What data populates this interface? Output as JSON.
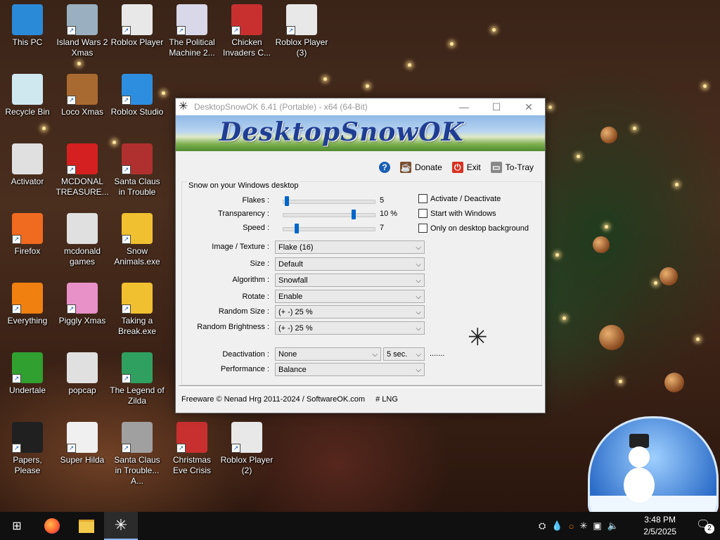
{
  "desktop": {
    "icons": [
      {
        "label": "This PC",
        "icon": "computer-icon",
        "color": "#2a8ad8",
        "shortcut": false
      },
      {
        "label": "Island Wars 2 Xmas",
        "icon": "game-icon",
        "color": "#9ab0c0",
        "shortcut": true
      },
      {
        "label": "Roblox Player",
        "icon": "roblox-icon",
        "color": "#e8e8e8",
        "shortcut": true
      },
      {
        "label": "The Political Machine 2...",
        "icon": "political-machine-icon",
        "color": "#d8d8e8",
        "shortcut": true
      },
      {
        "label": "Chicken Invaders C...",
        "icon": "chicken-invaders-icon",
        "color": "#c83030",
        "shortcut": true
      },
      {
        "label": "Roblox Player (3)",
        "icon": "roblox-icon",
        "color": "#e8e8e8",
        "shortcut": true
      },
      {
        "label": "Recycle Bin",
        "icon": "recycle-bin-icon",
        "color": "#cfe8f0",
        "shortcut": false
      },
      {
        "label": "Loco Xmas",
        "icon": "game-icon",
        "color": "#a86a30",
        "shortcut": true
      },
      {
        "label": "Roblox Studio",
        "icon": "roblox-studio-icon",
        "color": "#2d8ee0",
        "shortcut": true
      },
      {
        "label": "Activator",
        "icon": "file-icon",
        "color": "#e0e0e0",
        "shortcut": false
      },
      {
        "label": "MCDONAL TREASURE...",
        "icon": "mcdonalds-icon",
        "color": "#d42020",
        "shortcut": true
      },
      {
        "label": "Santa Claus in Trouble",
        "icon": "santa-icon",
        "color": "#b03030",
        "shortcut": true
      },
      {
        "label": "Firefox",
        "icon": "firefox-icon",
        "color": "#f06a20",
        "shortcut": true
      },
      {
        "label": "mcdonald games",
        "icon": "file-icon",
        "color": "#e0e0e0",
        "shortcut": false
      },
      {
        "label": "Snow Animals.exe",
        "icon": "snow-animals-icon",
        "color": "#f0c030",
        "shortcut": true
      },
      {
        "label": "Everything",
        "icon": "everything-search-icon",
        "color": "#f08010",
        "shortcut": true
      },
      {
        "label": "Piggly Xmas",
        "icon": "pig-icon",
        "color": "#e890c8",
        "shortcut": true
      },
      {
        "label": "Taking a Break.exe",
        "icon": "snow-animals-icon",
        "color": "#f0c030",
        "shortcut": true
      },
      {
        "label": "Undertale",
        "icon": "undertale-icon",
        "color": "#30a030",
        "shortcut": true
      },
      {
        "label": "popcap",
        "icon": "file-icon",
        "color": "#e0e0e0",
        "shortcut": false
      },
      {
        "label": "The Legend of Zilda",
        "icon": "game-icon",
        "color": "#30a060",
        "shortcut": true
      },
      {
        "label": "Papers, Please",
        "icon": "papers-please-icon",
        "color": "#202020",
        "shortcut": true
      },
      {
        "label": "Super Hilda",
        "icon": "game-icon",
        "color": "#f0f0f0",
        "shortcut": true
      },
      {
        "label": "Santa Claus in Trouble... A...",
        "icon": "santa-icon",
        "color": "#a0a0a0",
        "shortcut": true
      },
      {
        "label": "Christmas Eve Crisis",
        "icon": "santa-icon",
        "color": "#c83030",
        "shortcut": true
      },
      {
        "label": "Roblox Player (2)",
        "icon": "roblox-icon",
        "color": "#e8e8e8",
        "shortcut": true
      }
    ]
  },
  "window": {
    "title": "DesktopSnowOK 6.41 (Portable) - x64 (64-Bit)",
    "banner_text": "DesktopSnowOK",
    "links": {
      "help": "?",
      "donate": "Donate",
      "exit": "Exit",
      "tray": "To-Tray"
    },
    "group_title": "Snow on your Windows desktop",
    "sliders": [
      {
        "label": "Flakes :",
        "value": "5",
        "level": 0.02
      },
      {
        "label": "Transparency :",
        "value": "10 %",
        "level": 0.78
      },
      {
        "label": "Speed :",
        "value": "7",
        "level": 0.13
      }
    ],
    "checkboxes": [
      {
        "label": "Activate / Deactivate",
        "checked": false
      },
      {
        "label": "Start with Windows",
        "checked": false
      },
      {
        "label": "Only on desktop background",
        "checked": false
      }
    ],
    "combos": [
      {
        "label": "Image / Texture :",
        "value": "Flake (16)"
      },
      {
        "label": "Size :",
        "value": "Default"
      },
      {
        "label": "Algorithm :",
        "value": "Snowfall"
      },
      {
        "label": "Rotate :",
        "value": "Enable"
      },
      {
        "label": "Random Size :",
        "value": "(+ -) 25 %"
      },
      {
        "label": "Random Brightness :",
        "value": "(+ -) 25 %"
      }
    ],
    "deactivation": {
      "label": "Deactivation :",
      "value": "None",
      "time": "5 sec.",
      "dots": "......."
    },
    "performance": {
      "label": "Performance :",
      "value": "Balance"
    },
    "footer": {
      "copyright": "Freeware © Nenad Hrg 2011-2024 / SoftwareOK.com",
      "lng": "# LNG"
    }
  },
  "taskbar": {
    "time": "3:48 PM",
    "date": "2/5/2025",
    "notification_count": "2"
  }
}
